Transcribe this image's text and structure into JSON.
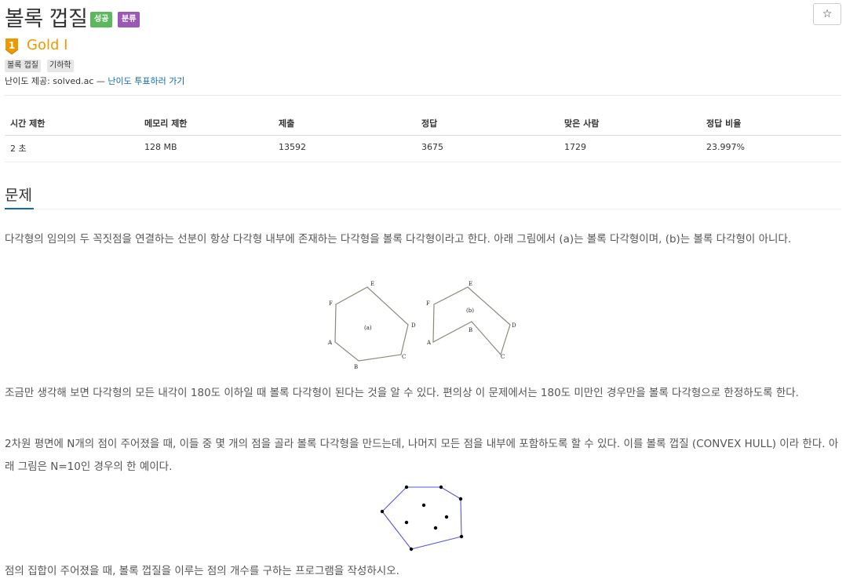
{
  "header": {
    "title": "볼록 껍질",
    "badge_success": "성공",
    "badge_category": "분류",
    "star_label": "☆"
  },
  "tier": {
    "number": "1",
    "name": "Gold I",
    "color": "#ec9a00"
  },
  "tags": [
    "볼록 껍질",
    "기하학"
  ],
  "difficulty": {
    "prefix": "난이도 제공: solved.ac — ",
    "link": "난이도 투표하러 가기"
  },
  "info_table": {
    "headers": [
      "시간 제한",
      "메모리 제한",
      "제출",
      "정답",
      "맞은 사람",
      "정답 비율"
    ],
    "values": [
      "2 초",
      "128 MB",
      "13592",
      "3675",
      "1729",
      "23.997%"
    ]
  },
  "section": {
    "title": "문제"
  },
  "paragraphs": [
    "다각형의 임의의 두 꼭짓점을 연결하는 선분이 항상 다각형 내부에 존재하는 다각형을 볼록 다각형이라고 한다. 아래 그림에서 (a)는 볼록 다각형이며, (b)는 볼록 다각형이 아니다.",
    "조금만 생각해 보면 다각형의 모든 내각이 180도 이하일 때 볼록 다각형이 된다는 것을 알 수 있다. 편의상 이 문제에서는 180도 미만인 경우만을 볼록 다각형으로 한정하도록 한다.",
    "2차원 평면에 N개의 점이 주어졌을 때, 이들 중 몇 개의 점을 골라 볼록 다각형을 만드는데, 나머지 모든 점을 내부에 포함하도록 할 수 있다. 이를 볼록 껍질 (CONVEX HULL) 이라 한다. 아래 그림은 N=10인 경우의 한 예이다.",
    "점의 집합이 주어졌을 때, 볼록 껍질을 이루는 점의 개수를 구하는 프로그램을 작성하시오."
  ],
  "figure_a": {
    "label": "(a)",
    "vertices": [
      "A",
      "B",
      "C",
      "D",
      "E",
      "F"
    ]
  },
  "figure_b": {
    "label": "(b)",
    "vertices": [
      "A",
      "B",
      "C",
      "D",
      "E",
      "F"
    ]
  },
  "colors": {
    "link": "#0b6bb4",
    "hull": "#5555dd",
    "success": "#5cb85c",
    "category": "#9b59b6"
  }
}
